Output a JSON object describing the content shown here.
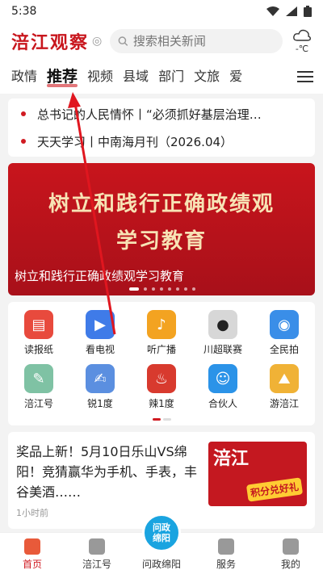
{
  "status": {
    "time": "5:38"
  },
  "header": {
    "logo": "涪江观察",
    "search_placeholder": "搜索相关新闻",
    "weather_temp": "-℃"
  },
  "tabs": [
    "政情",
    "推荐",
    "视频",
    "县域",
    "部门",
    "文旅",
    "爱"
  ],
  "active_tab": "推荐",
  "headlines": [
    "总书记的人民情怀丨“必须抓好基层治理…",
    "天天学习丨中南海月刊（2026.04）"
  ],
  "banner": {
    "title_line1": "树立和践行正确政绩观",
    "title_line2": "学习教育",
    "caption": "树立和践行正确政绩观学习教育"
  },
  "grid": [
    {
      "label": "读报纸",
      "color": "#e84a3d",
      "icon": "newspaper-icon"
    },
    {
      "label": "看电视",
      "color": "#3f7be8",
      "icon": "tv-icon"
    },
    {
      "label": "听广播",
      "color": "#f3a321",
      "icon": "radio-icon"
    },
    {
      "label": "川超联赛",
      "color": "#d7d7d7",
      "icon": "panda-icon"
    },
    {
      "label": "全民拍",
      "color": "#3a8ee8",
      "icon": "camera-icon"
    },
    {
      "label": "涪江号",
      "color": "#7fc2a4",
      "icon": "account-icon"
    },
    {
      "label": "锐1度",
      "color": "#5b8fe0",
      "icon": "document-icon"
    },
    {
      "label": "辣1度",
      "color": "#d83a2e",
      "icon": "chili-icon"
    },
    {
      "label": "合伙人",
      "color": "#2b93e8",
      "icon": "partner-icon"
    },
    {
      "label": "游涪江",
      "color": "#f0b236",
      "icon": "travel-icon"
    }
  ],
  "news": {
    "title": "奖品上新！5月10日乐山VS绵阳！竞猜赢华为手机、手表，丰谷美酒……",
    "time": "1小时前",
    "thumb_text1": "涪江",
    "thumb_text2": "积分兑好礼"
  },
  "bottom_nav": {
    "home": "首页",
    "fujiang": "涪江号",
    "center": "问政绵阳",
    "center_badge": "问政\n绵阳",
    "service": "服务",
    "mine": "我的"
  }
}
